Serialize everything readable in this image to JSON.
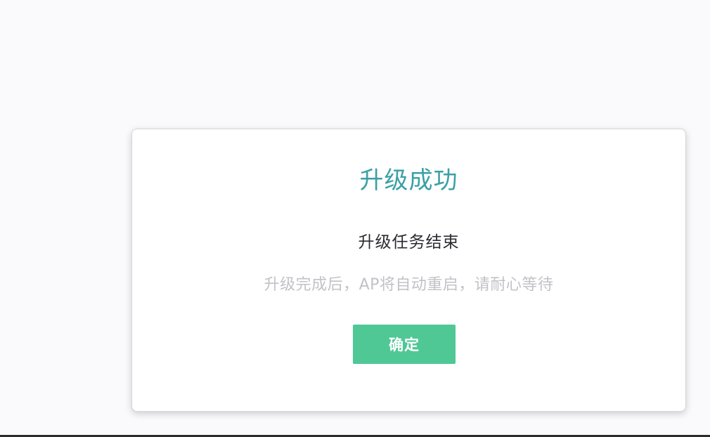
{
  "dialog": {
    "title": "升级成功",
    "subtitle": "升级任务结束",
    "message": "升级完成后，AP将自动重启，请耐心等待",
    "confirm_label": "确定"
  },
  "colors": {
    "title": "#3aa0a6",
    "subtitle": "#2a2a30",
    "message": "#c3c1c7",
    "button_bg": "#4fc896",
    "button_text": "#ffffff",
    "background": "#fafafc"
  }
}
